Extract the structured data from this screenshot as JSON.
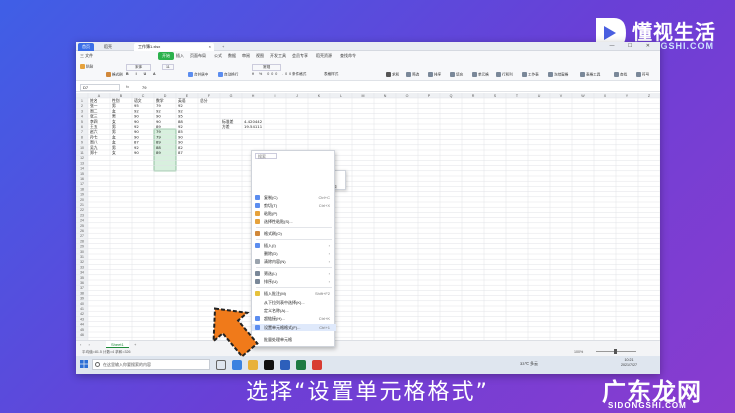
{
  "brand_top": {
    "cn": "懂视生活",
    "en": "IDONGSHI.COM"
  },
  "window": {
    "tabs": [
      "首页",
      "稻壳",
      "工作簿1.xlsx",
      "+"
    ],
    "controls": "— ☐ ✕"
  },
  "menu": [
    "三 文件",
    "开始",
    "插入",
    "页面布局",
    "公式",
    "数据",
    "审阅",
    "视图",
    "开发工具",
    "会员专享",
    "稻壳资源",
    "查找命令"
  ],
  "ribbon": {
    "font": "宋体",
    "size": "11",
    "format": "常规",
    "labels": [
      "粘贴",
      "格式刷",
      "合并居中",
      "自动换行",
      "条件格式",
      "表格样式",
      "求和",
      "筛选",
      "排序",
      "填充",
      "单元格",
      "行和列",
      "工作表",
      "冻结窗格",
      "表格工具",
      "查找",
      "符号"
    ]
  },
  "formula": {
    "cell": "D7",
    "fx": "fx",
    "value": "79"
  },
  "columns": [
    "A",
    "B",
    "C",
    "D",
    "E",
    "F",
    "G",
    "H",
    "I",
    "J",
    "K",
    "L",
    "M",
    "N",
    "O",
    "P",
    "Q",
    "R",
    "S",
    "T",
    "U",
    "V",
    "W",
    "X",
    "Y",
    "Z"
  ],
  "table": {
    "header": [
      "姓名",
      "性别",
      "语文",
      "数学",
      "英语",
      "总分"
    ],
    "rows": [
      [
        "张一",
        "男",
        "95",
        "79",
        "92"
      ],
      [
        "周二",
        "女",
        "92",
        "92",
        "92"
      ],
      [
        "张三",
        "男",
        "90",
        "90",
        "95"
      ],
      [
        "李四",
        "女",
        "90",
        "90",
        "88"
      ],
      [
        "王五",
        "男",
        "92",
        "89",
        "92"
      ],
      [
        "赵六",
        "男",
        "90",
        "79",
        "85"
      ],
      [
        "孙七",
        "女",
        "90",
        "79",
        "90"
      ],
      [
        "周八",
        "女",
        "87",
        "89",
        "90"
      ],
      [
        "吴九",
        "男",
        "92",
        "88",
        "82"
      ],
      [
        "郑十",
        "女",
        "90",
        "89",
        "87"
      ]
    ],
    "side": [
      [
        "标准差",
        "4.420442"
      ],
      [
        "方差",
        "19.54111"
      ]
    ]
  },
  "context_menu": {
    "search": "搜索",
    "items": [
      {
        "label": "复制(C)",
        "sc": "Ctrl+C"
      },
      {
        "label": "剪切(T)",
        "sc": "Ctrl+X"
      },
      {
        "label": "粘贴(P)",
        "sc": ""
      },
      {
        "label": "选择性粘贴(S)...",
        "sc": ""
      },
      {
        "label": "格式刷(O)",
        "sc": ""
      },
      {
        "label": "插入(I)",
        "sc": ""
      },
      {
        "label": "删除(D)",
        "sc": ""
      },
      {
        "label": "清除内容(N)",
        "sc": ""
      },
      {
        "label": "筛选(L)",
        "sc": ""
      },
      {
        "label": "排序(U)",
        "sc": ""
      },
      {
        "label": "插入批注(M)",
        "sc": "Shift+F2"
      },
      {
        "label": "从下拉列表中选择(K)...",
        "sc": ""
      },
      {
        "label": "定义名称(A)...",
        "sc": ""
      },
      {
        "label": "超链接(H)...",
        "sc": "Ctrl+K"
      },
      {
        "label": "设置单元格格式(F)...",
        "sc": "Ctrl+1"
      },
      {
        "label": "批量处理单元格",
        "sc": ""
      }
    ]
  },
  "minitoolbar": {
    "font": "宋体",
    "size": "11",
    "merge": "合并",
    "autosum": "自动求和"
  },
  "sheet": {
    "tab": "Sheet1",
    "plus": "+"
  },
  "status": {
    "left": "平均值=81.5  计数=4  求和=326",
    "zoom": "100%"
  },
  "taskbar": {
    "search": "在这里输入你要搜索的内容",
    "temp": "33℃ 多云",
    "time": "10:21",
    "date": "2021/7/27"
  },
  "caption": "选择“设置单元格格式”",
  "brand_bottom": {
    "cn": "广东龙网",
    "en": "SIDONGSHI.COM"
  }
}
